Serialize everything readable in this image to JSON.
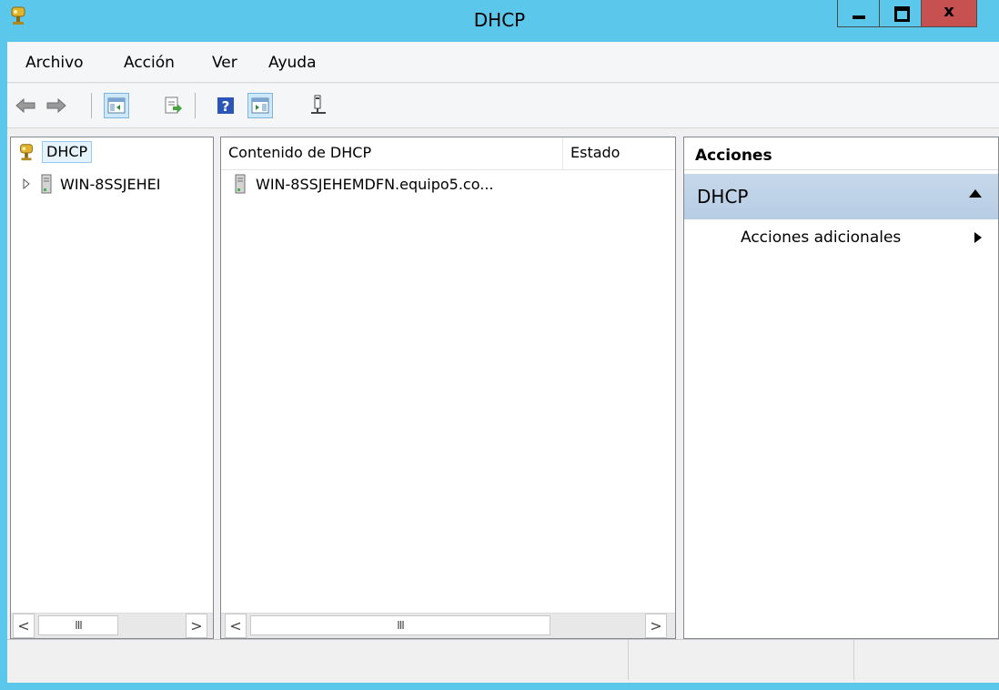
{
  "window": {
    "title": "DHCP",
    "close_glyph": "x"
  },
  "menu": [
    "Archivo",
    "Acción",
    "Ver",
    "Ayuda"
  ],
  "toolbar": [
    "back-icon",
    "forward-icon",
    "show-hide-tree-icon",
    "export-list-icon",
    "help-icon",
    "show-hide-action-pane-icon",
    "dhcp-server-icon"
  ],
  "tree": {
    "root": "DHCP",
    "child": "WIN-8SSJEHEI"
  },
  "list": {
    "columns": [
      "Contenido de DHCP",
      "Estado"
    ],
    "rows": [
      {
        "name": "WIN-8SSJEHEMDFN.equipo5.co...",
        "status": ""
      }
    ]
  },
  "actions": {
    "header": "Acciones",
    "section": "DHCP",
    "item": "Acciones adicionales"
  },
  "scroll": {
    "left": "<",
    "right": ">",
    "thumb": "III"
  },
  "colors": {
    "titlebar": "#5bc7eb",
    "close_button": "#c75050",
    "selection": "#cde8f8"
  }
}
